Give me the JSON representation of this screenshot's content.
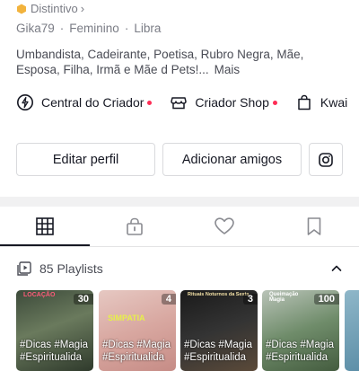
{
  "profile": {
    "badge_label": "Distintivo",
    "badge_chevron": "›",
    "meta": [
      "Gika79",
      "·",
      "Feminino",
      "·",
      "Libra"
    ],
    "bio_line1": "Umbandista, Cadeirante, Poetisa, Rubro Negra, Mãe,",
    "bio_line2": "Esposa, Filha, Irmã e Mãe d Pets!...",
    "bio_more": "Mais"
  },
  "links": [
    {
      "label": "Central do Criador",
      "icon": "bulb-icon",
      "dot": true
    },
    {
      "label": "Criador Shop",
      "icon": "shop-icon",
      "dot": true
    },
    {
      "label": "Kwai",
      "icon": "bag-icon",
      "dot": false
    }
  ],
  "buttons": {
    "edit_profile": "Editar perfil",
    "add_friends": "Adicionar amigos",
    "instagram_icon": "instagram-icon"
  },
  "tabs": [
    {
      "icon": "grid-icon",
      "active": true
    },
    {
      "icon": "lock-icon",
      "active": false
    },
    {
      "icon": "heart-icon",
      "active": false
    },
    {
      "icon": "bookmark-icon",
      "active": false
    }
  ],
  "playlists": {
    "header": "85 Playlists",
    "cards": [
      {
        "count": "30",
        "caption1": "#Dicas #Magia",
        "caption2": "#Espiritualida",
        "title": "LOCAÇÃO"
      },
      {
        "count": "4",
        "caption1": "#Dicas #Magia",
        "caption2": "#Espiritualida",
        "title": "SIMPATIA"
      },
      {
        "count": "3",
        "caption1": "#Dicas #Magia",
        "caption2": "#Espiritualida",
        "title": "Rituais Noturnos da Sexta"
      },
      {
        "count": "100",
        "caption1": "#Dicas #Magia",
        "caption2": "#Espiritualida",
        "title": "Queimação Magia"
      }
    ]
  },
  "colors": {
    "accent_dot": "#fe2c55",
    "badge_hex": "#f2b33d",
    "text_primary": "#161823",
    "text_secondary": "#7a7c85"
  }
}
